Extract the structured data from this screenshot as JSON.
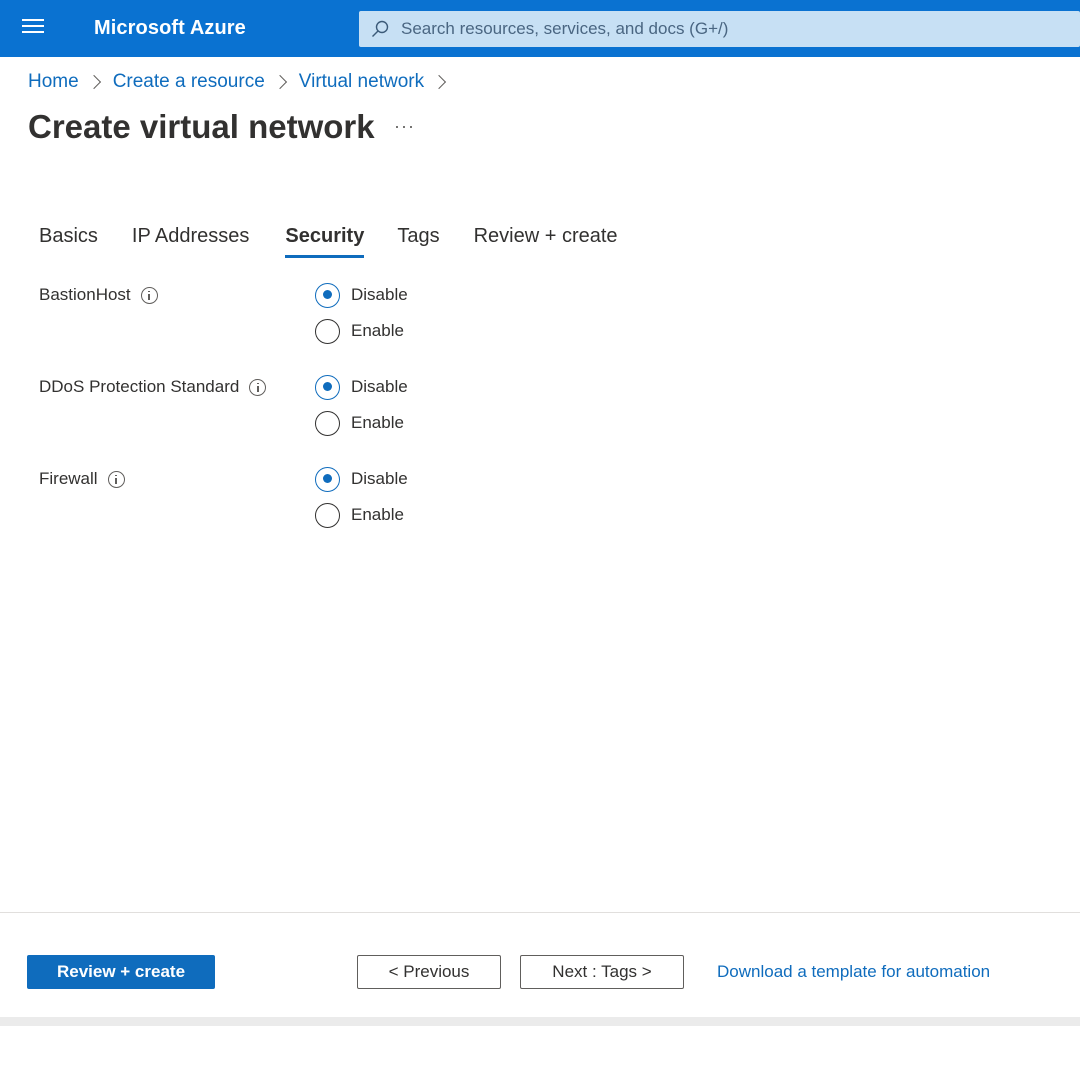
{
  "header": {
    "brand": "Microsoft Azure",
    "search_placeholder": "Search resources, services, and docs (G+/)",
    "hamburger_icon": "hamburger-menu-icon",
    "search_icon": "search-icon",
    "accent_color": "#0a72d1"
  },
  "breadcrumb": {
    "items": [
      "Home",
      "Create a resource",
      "Virtual network"
    ]
  },
  "page": {
    "title": "Create virtual network",
    "more_label": "···"
  },
  "tabs": {
    "items": [
      "Basics",
      "IP Addresses",
      "Security",
      "Tags",
      "Review + create"
    ],
    "active": "Security"
  },
  "security": {
    "rows": [
      {
        "label": "BastionHost",
        "options": [
          "Disable",
          "Enable"
        ],
        "selected": "Disable"
      },
      {
        "label": "DDoS Protection Standard",
        "options": [
          "Disable",
          "Enable"
        ],
        "selected": "Disable"
      },
      {
        "label": "Firewall",
        "options": [
          "Disable",
          "Enable"
        ],
        "selected": "Disable"
      }
    ]
  },
  "footer": {
    "review_create_label": "Review + create",
    "previous_label": "< Previous",
    "next_label": "Next : Tags >",
    "download_label": "Download a template for automation"
  }
}
